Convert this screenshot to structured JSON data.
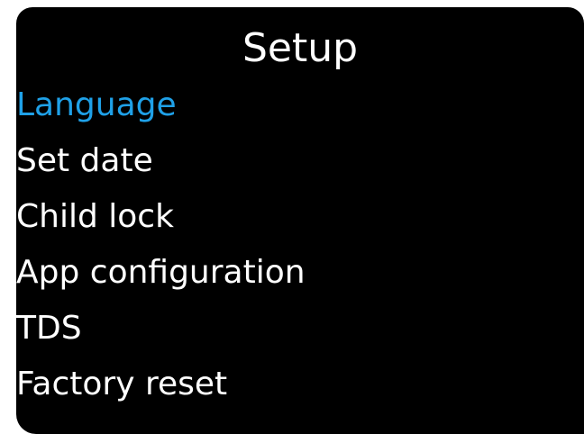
{
  "screen": {
    "title": "Setup",
    "selected_color": "#1fa1e8",
    "menu": [
      {
        "label": "Language",
        "selected": true
      },
      {
        "label": "Set date",
        "selected": false
      },
      {
        "label": "Child lock",
        "selected": false
      },
      {
        "label": "App configuration",
        "selected": false
      },
      {
        "label": "TDS",
        "selected": false
      },
      {
        "label": "Factory reset",
        "selected": false
      }
    ]
  }
}
